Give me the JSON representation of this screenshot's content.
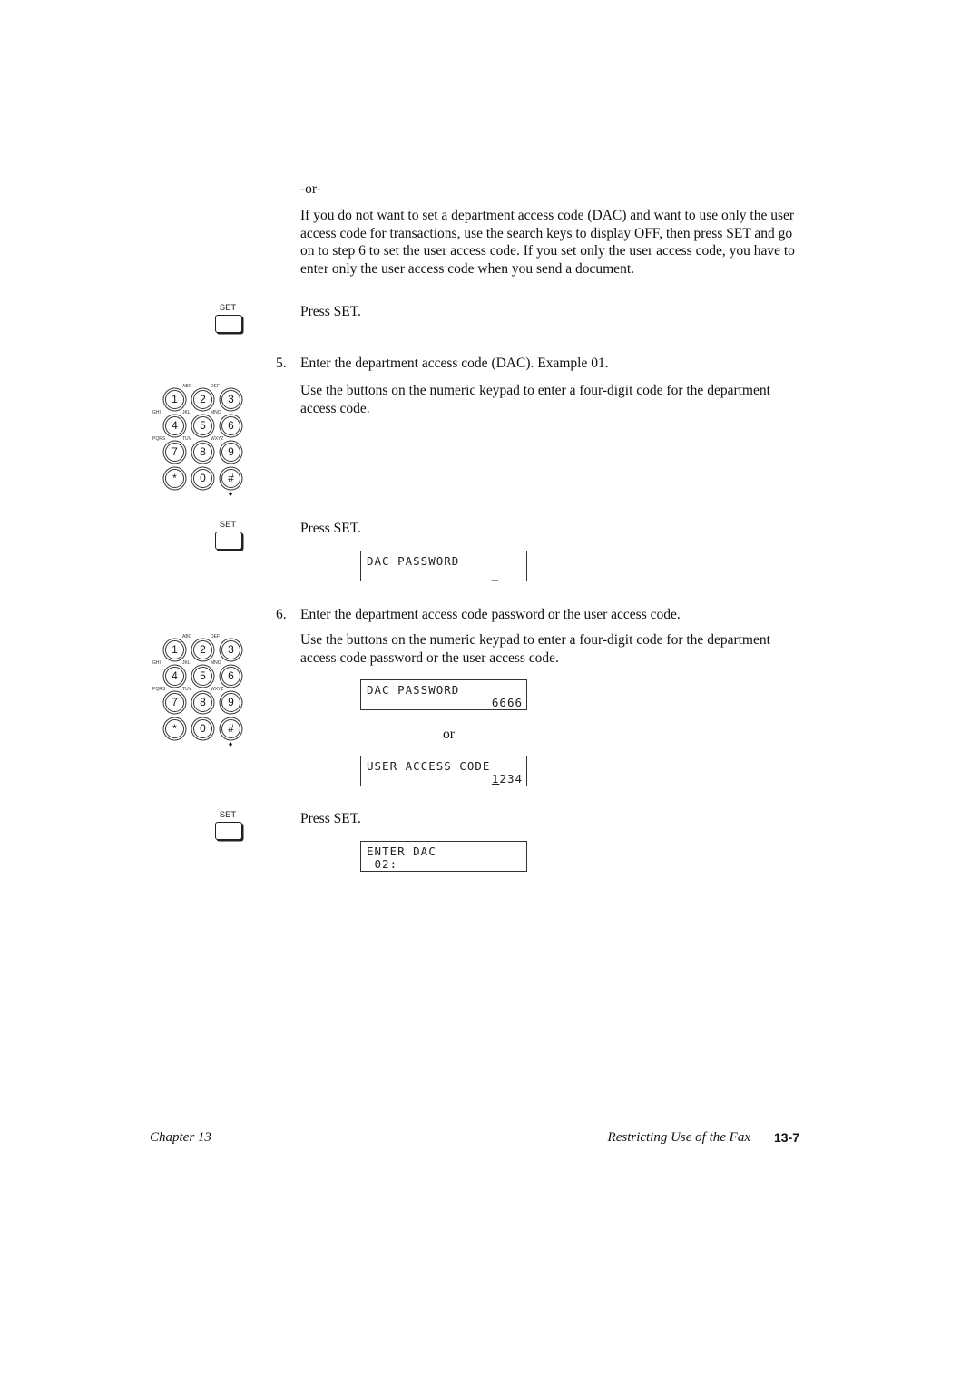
{
  "intro": {
    "or_label": "-or-",
    "paragraph": "If you do not want to set a department access code (DAC) and want to use only the user access code for transactions, use the search keys to display OFF, then press SET and go on to step 6 to set the user access code. If you set only the user access code, you have to enter only the user access code when you send a document.",
    "press_set": "Press SET."
  },
  "set_key": {
    "label": "SET"
  },
  "keypad": {
    "keys": [
      "1",
      "2",
      "3",
      "4",
      "5",
      "6",
      "7",
      "8",
      "9",
      "*",
      "0",
      "#"
    ],
    "letters": {
      "2": "ABC",
      "3": "DEF",
      "4": "GHI",
      "5": "JKL",
      "6": "MNO",
      "7": "PQRS",
      "8": "TUV",
      "9": "WXYZ"
    }
  },
  "step5": {
    "number": "5.",
    "title": "Enter the department access code (DAC). Example 01.",
    "description": "Use the buttons on the numeric keypad to enter a four-digit code for the department access code.",
    "press_set": "Press SET.",
    "lcd": {
      "line1": "DAC PASSWORD",
      "line2": "_"
    }
  },
  "step6": {
    "number": "6.",
    "title": "Enter the department access code password or the user access code.",
    "description": "Use the buttons on the numeric keypad to enter a four-digit code for the department access code password or the user access code.",
    "lcd_dac": {
      "line1": "DAC PASSWORD",
      "line2_cursor": "6",
      "line2_rest": "666"
    },
    "or_label": "or",
    "lcd_user": {
      "line1": "USER ACCESS CODE",
      "line2_cursor": "1",
      "line2_rest": "234"
    },
    "press_set": "Press SET.",
    "lcd_enter": {
      "line1": "ENTER DAC",
      "line2": " 02:"
    }
  },
  "footer": {
    "chapter": "Chapter 13",
    "section": "Restricting Use of the Fax",
    "page": "13-7"
  }
}
